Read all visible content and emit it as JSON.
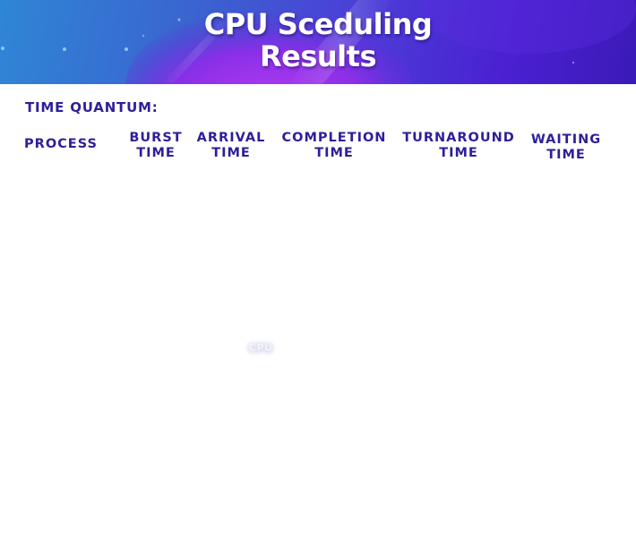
{
  "banner": {
    "title_line1": "CPU Sceduling",
    "title_line2": "Results"
  },
  "quantum": {
    "label": "TIME QUANTUM:",
    "value": ""
  },
  "table": {
    "headers": [
      {
        "line1": "PROCESS",
        "line2": ""
      },
      {
        "line1": "BURST",
        "line2": "TIME"
      },
      {
        "line1": "ARRIVAL",
        "line2": "TIME"
      },
      {
        "line1": "COMPLETION",
        "line2": "TIME"
      },
      {
        "line1": "TURNAROUND",
        "line2": "TIME"
      },
      {
        "line1": "WAITING",
        "line2": "TIME"
      }
    ],
    "rows": []
  },
  "overlay": {
    "text": "CPU"
  },
  "colors": {
    "heading": "#2d1f9a",
    "banner_start": "#2f86d6",
    "banner_end": "#3a1ab8",
    "accent_blob": "#9b2fe6"
  }
}
